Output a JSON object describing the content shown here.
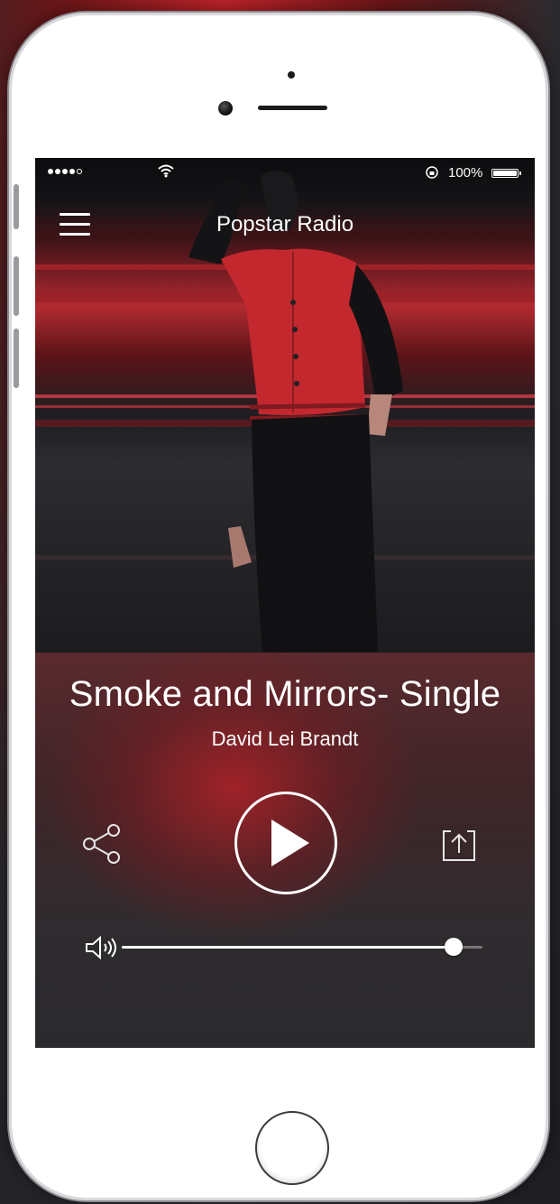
{
  "status_bar": {
    "signal_bars": 4,
    "signal_total": 5,
    "battery_percent": "100%"
  },
  "nav": {
    "title": "Popstar Radio",
    "menu_icon": "hamburger-menu-icon"
  },
  "now_playing": {
    "title": "Smoke and Mirrors- Single",
    "artist": "David Lei Brandt"
  },
  "controls": {
    "share_icon": "share-icon",
    "play_icon": "play-icon",
    "export_icon": "export-icon"
  },
  "volume": {
    "icon": "speaker-icon",
    "level": 0.92
  },
  "colors": {
    "accent_red": "#b02a30",
    "text": "#ffffff",
    "phone_body": "#ffffff"
  }
}
